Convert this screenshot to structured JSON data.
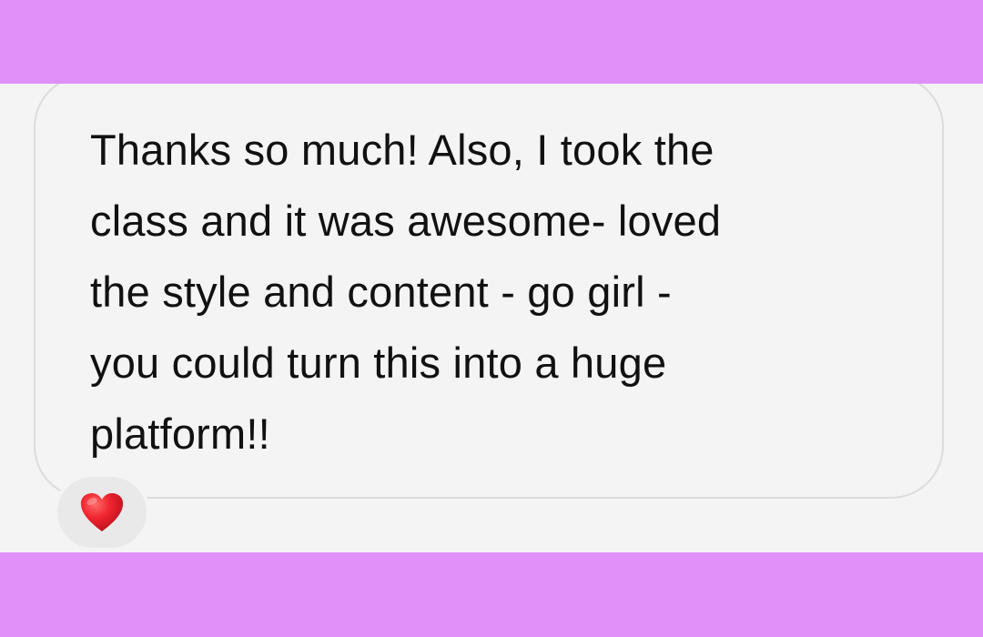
{
  "colors": {
    "background_band": "#e190fa",
    "screen_background": "#f4f4f4",
    "bubble_border": "#dcdcdc",
    "text": "#111111",
    "reaction_background": "#e9e9e9",
    "heart": "#e0202a"
  },
  "message": {
    "lines": [
      "Thanks so much! Also, I took the",
      "class and it was awesome- loved",
      "the style and content - go girl -",
      "you could turn this into a huge",
      "platform!!"
    ]
  },
  "reaction": {
    "icon": "red-heart-icon"
  }
}
